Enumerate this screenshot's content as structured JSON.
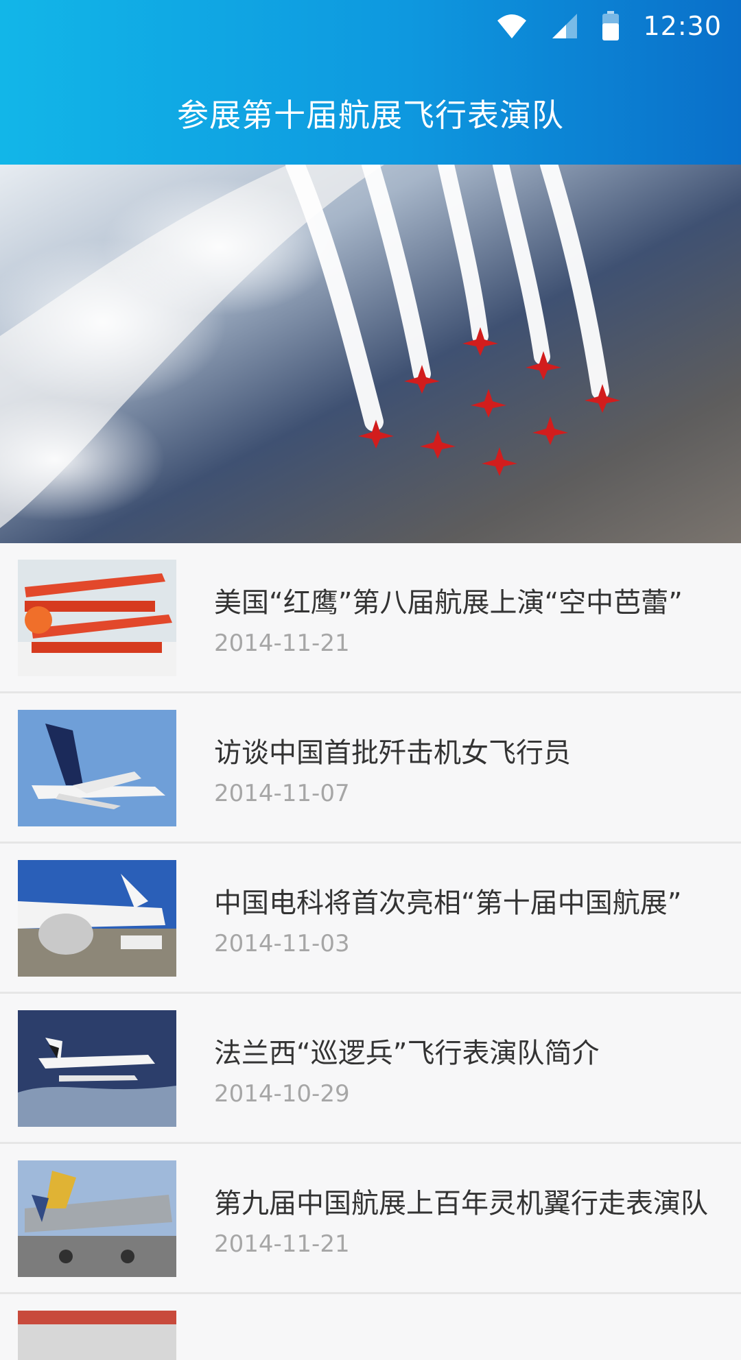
{
  "status_bar": {
    "time": "12:30",
    "icons": [
      "wifi-icon",
      "signal-icon",
      "battery-icon"
    ]
  },
  "header": {
    "title": "参展第十届航展飞行表演队"
  },
  "hero": {
    "image": "red-arrows-formation-photo"
  },
  "news": [
    {
      "title": "美国“红鹰”第八届航展上演“空中芭蕾”",
      "date": "2014-11-21",
      "thumb": "biplanes-photo"
    },
    {
      "title": "访谈中国首批歼击机女飞行员",
      "date": "2014-11-07",
      "thumb": "jet-airliner-photo"
    },
    {
      "title": "中国电科将首次亮相“第十届中国航展”",
      "date": "2014-11-03",
      "thumb": "airliner-on-ground-photo"
    },
    {
      "title": "法兰西“巡逻兵”飞行表演队简介",
      "date": "2014-10-29",
      "thumb": "seaplane-photo"
    },
    {
      "title": "第九届中国航展上百年灵机翼行走表演队",
      "date": "2014-11-21",
      "thumb": "fighter-jet-photo"
    }
  ],
  "colors": {
    "header_start": "#12b6e8",
    "header_end": "#0a6fc9",
    "title_text": "#333333",
    "date_text": "#a6a6a6"
  }
}
